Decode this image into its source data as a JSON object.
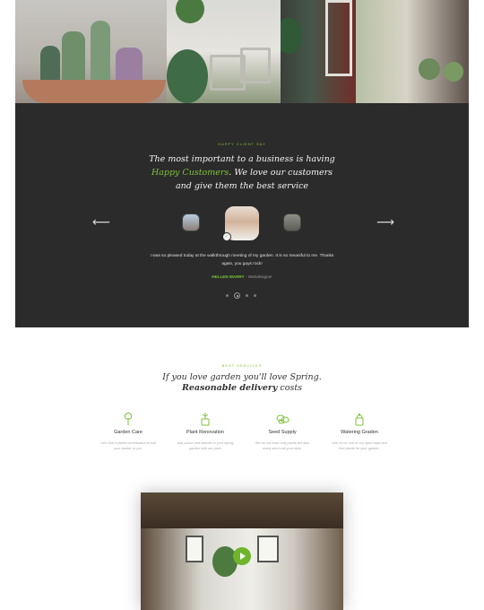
{
  "colors": {
    "accent": "#7cc23a",
    "dark_panel": "#2b2b2b",
    "background": "#ffffff"
  },
  "gallery": {
    "images": [
      "cactus-planter-image",
      "patio-chairs-image",
      "interior-plants-image",
      "window-plants-image"
    ]
  },
  "testimonial": {
    "kicker": "HAPPY CLIENT SAY",
    "quote_line1": "The most important to a business is having",
    "quote_highlight": "Happy Customers",
    "quote_line2_rest": ". We love our customers",
    "quote_line3": "and give them the best service",
    "body_line1": "I was so pleased today at the walkthrough meeting of my garden. It is so meaniful to me. Thanks",
    "body_line2": "again, you guys rock!",
    "author_name": "HELLEN MARRY",
    "author_role": " - Webdesigner",
    "prev_icon": "arrow-left-icon",
    "next_icon": "arrow-right-icon",
    "arrow_left": "⟵",
    "arrow_right": "⟶",
    "verified_glyph": "✓",
    "dots_count": 4,
    "active_dot": 2
  },
  "services": {
    "kicker": "BEST SERVICES",
    "title_line1": "If you love garden you'll love Spring.",
    "title_bold": "Reasonable delivery",
    "title_rest": " costs",
    "items": [
      {
        "icon": "sprout-icon",
        "name": "Garden Care",
        "desc_line1": "Let's find a plants combination to suit",
        "desc_line2": "your border or pot."
      },
      {
        "icon": "planter-icon",
        "name": "Plant Renovation",
        "desc_line1": "Add colour and interest to your spring",
        "desc_line2": "garden with our plant"
      },
      {
        "icon": "seed-icon",
        "name": "Seed Supply",
        "desc_line1": "We do not have only plants but also",
        "desc_line2": "many seed suit your style."
      },
      {
        "icon": "watering-can-icon",
        "name": "Watering Graden",
        "desc_line1": "Join us for one of our open days and",
        "desc_line2": "find plants for your garden."
      }
    ]
  },
  "video": {
    "play_icon": "play-icon"
  }
}
